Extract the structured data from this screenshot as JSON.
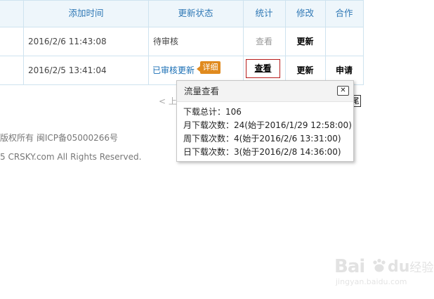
{
  "table": {
    "headers": {
      "added_time": "添加时间",
      "update_status": "更新状态",
      "stats": "统计",
      "modify": "修改",
      "cooperate": "合作"
    },
    "rows": [
      {
        "added_time": "2016/2/6 11:43:08",
        "status": "待审核",
        "stats": "查看",
        "modify": "更新",
        "cooperate": ""
      },
      {
        "added_time": "2016/2/5 13:41:04",
        "status": "已审核更新",
        "badge": "详细",
        "stats": "查看",
        "modify": "更新",
        "cooperate": "申请"
      }
    ]
  },
  "pagination": {
    "prev_label": "< 上"
  },
  "underlay_button_label": "尾",
  "footer": {
    "icp_line": "版权所有 闽ICP备05000266号",
    "rights_line": "5 CRSKY.com All Rights Reserved."
  },
  "popup": {
    "title": "流量查看",
    "close_label": "✕",
    "lines": [
      "下载总计：106",
      "月下载次数：24(始于2016/1/29 12:58:00)",
      "周下载次数：4(始于2016/2/6 13:31:00)",
      "日下载次数：3(始于2016/2/8 14:36:00)"
    ]
  },
  "watermark": {
    "brand_part1": "Bai",
    "brand_part2": "du",
    "brand_suffix": "经验",
    "site": "jingyan.baidu.com"
  },
  "colors": {
    "header_text": "#2f78b5",
    "status_approved": "#1a6fb5",
    "badge": "#e08a1e",
    "active_border": "#b71c1c"
  }
}
